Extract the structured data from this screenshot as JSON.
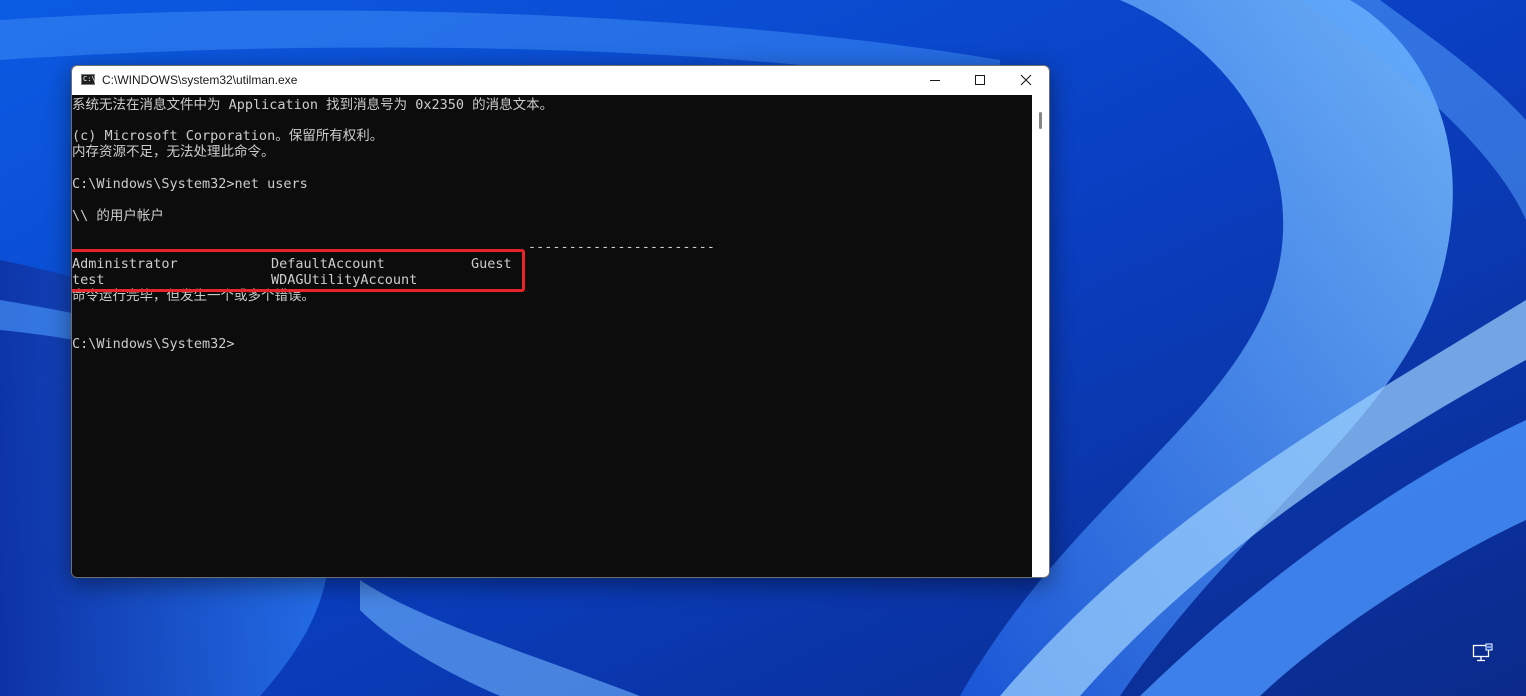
{
  "window": {
    "title": "C:\\WINDOWS\\system32\\utilman.exe",
    "icon_label": "C:\\"
  },
  "console": {
    "lines": [
      "系统无法在消息文件中为 Application 找到消息号为 0x2350 的消息文本。",
      "(c) Microsoft Corporation。保留所有权利。",
      "内存资源不足，无法处理此命令。",
      "C:\\Windows\\System32>net users",
      "\\\\ 的用户帐户",
      "-----------------------",
      "命令运行完毕，但发生一个或多个错误。",
      "C:\\Windows\\System32>"
    ],
    "users": [
      [
        "Administrator",
        "DefaultAccount",
        "Guest"
      ],
      [
        "test",
        "WDAGUtilityAccount",
        ""
      ]
    ]
  },
  "colors": {
    "console_bg": "#0c0c0c",
    "console_text": "#cccccc",
    "highlight": "#e8232a",
    "titlebar_bg": "#ffffff"
  },
  "icons": {
    "window_icon": "cmd-icon",
    "minimize": "minimize-icon",
    "maximize": "maximize-icon",
    "close": "close-icon",
    "tray": "network-monitor-icon"
  }
}
